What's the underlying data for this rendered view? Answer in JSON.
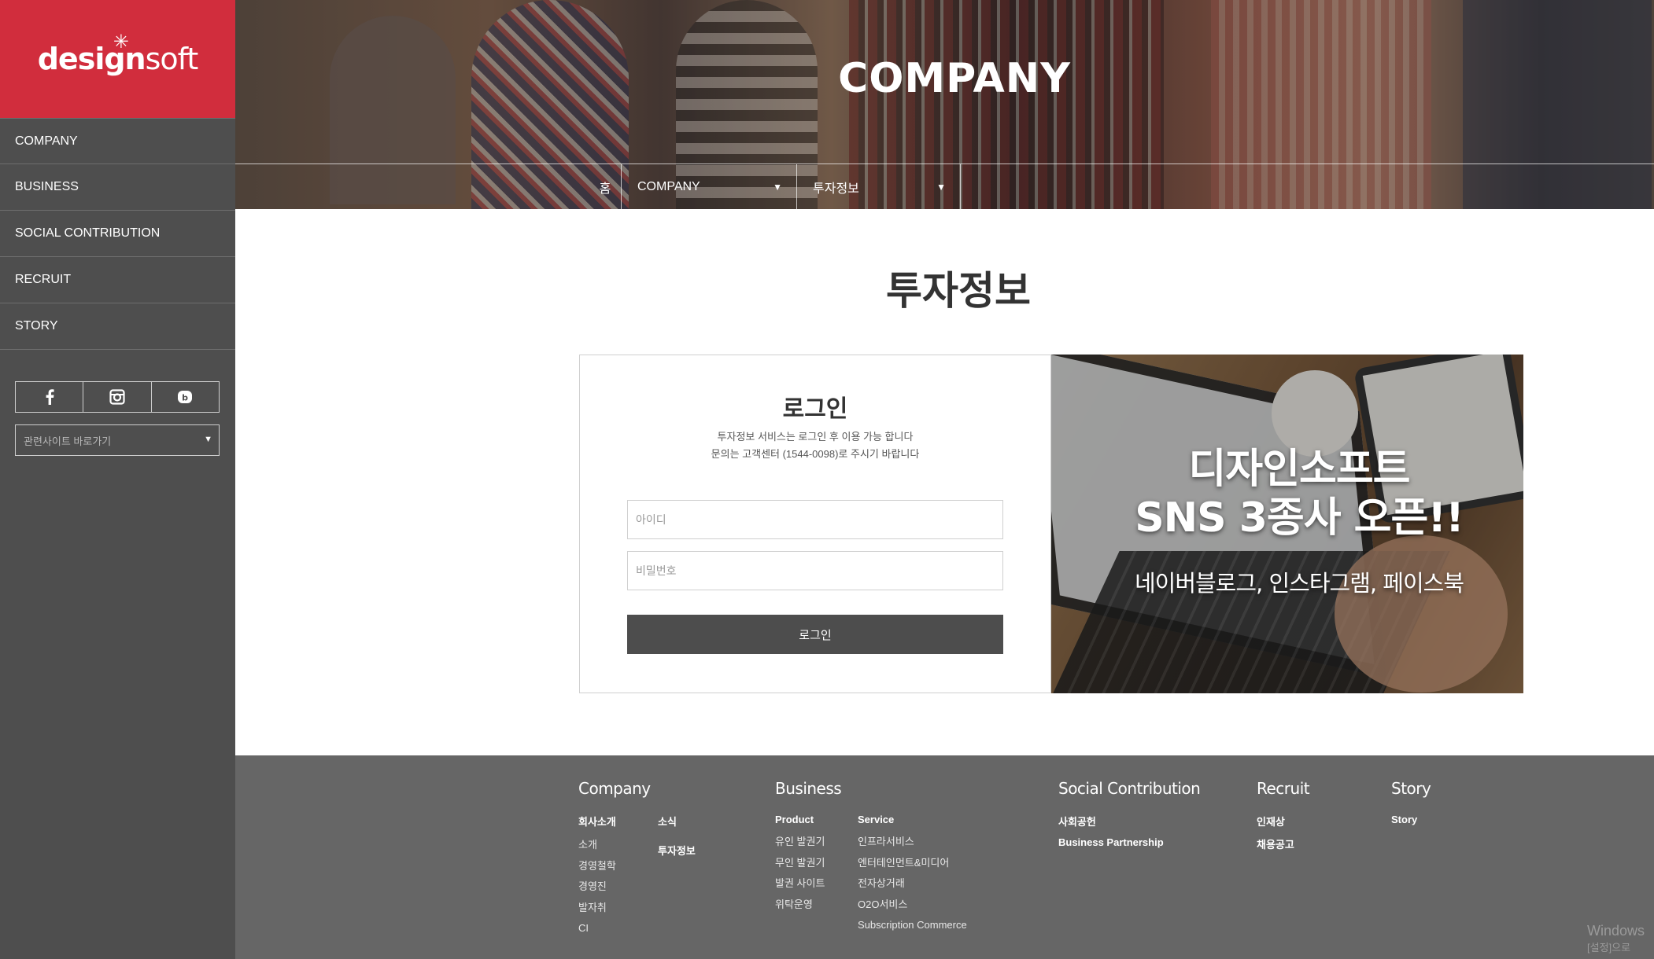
{
  "brand": {
    "logo": "designsoft",
    "logo_bold": "design",
    "logo_light": "soft"
  },
  "sidebar": {
    "items": [
      {
        "label": "COMPANY"
      },
      {
        "label": "BUSINESS"
      },
      {
        "label": "SOCIAL CONTRIBUTION"
      },
      {
        "label": "RECRUIT"
      },
      {
        "label": "STORY"
      }
    ],
    "sns": [
      "facebook-icon",
      "instagram-icon",
      "blog-icon"
    ],
    "site_select": "관련사이트 바로가기"
  },
  "hero": {
    "title": "COMPANY",
    "breadcrumb": {
      "home": "홈",
      "level1": "COMPANY",
      "level2": "투자정보"
    }
  },
  "main": {
    "title": "투자정보",
    "login": {
      "title": "로그인",
      "desc_line1": "투자정보 서비스는 로그인 후 이용 가능 합니다",
      "desc_line2": "문의는 고객센터 (1544-0098)로 주시기 바랍니다",
      "id_placeholder": "아이디",
      "pw_placeholder": "비밀번호",
      "button": "로그인"
    },
    "promo": {
      "line1": "디자인소프트",
      "line2": "SNS 3종사 오픈!!",
      "sub": "네이버블로그, 인스타그램, 페이스북"
    }
  },
  "footer": {
    "company": {
      "title": "Company",
      "col1_head": "회사소개",
      "col1_items": [
        "소개",
        "경영철학",
        "경영진",
        "발자취",
        "CI"
      ],
      "col2_head": "소식",
      "col2_head2": "투자정보"
    },
    "business": {
      "title": "Business",
      "col1_head": "Product",
      "col1_items": [
        "유인 발권기",
        "무인 발권기",
        "발권 사이트",
        "위탁운영"
      ],
      "col2_head": "Service",
      "col2_items": [
        "인프라서비스",
        "엔터테인먼트&미디어",
        "전자상거래",
        "O2O서비스",
        "Subscription Commerce"
      ]
    },
    "social": {
      "title": "Social Contribution",
      "head1": "사회공헌",
      "head2": "Business Partnership"
    },
    "recruit": {
      "title": "Recruit",
      "head1": "인재상",
      "head2": "채용공고"
    },
    "story": {
      "title": "Story",
      "head1": "Story"
    },
    "watermark_line1": "Windows",
    "watermark_line2": "[설정]으로"
  },
  "colors": {
    "brand_red": "#d12d3d",
    "sidebar": "#4e4e4e",
    "footer": "#666666",
    "button": "#4d4d4d"
  }
}
